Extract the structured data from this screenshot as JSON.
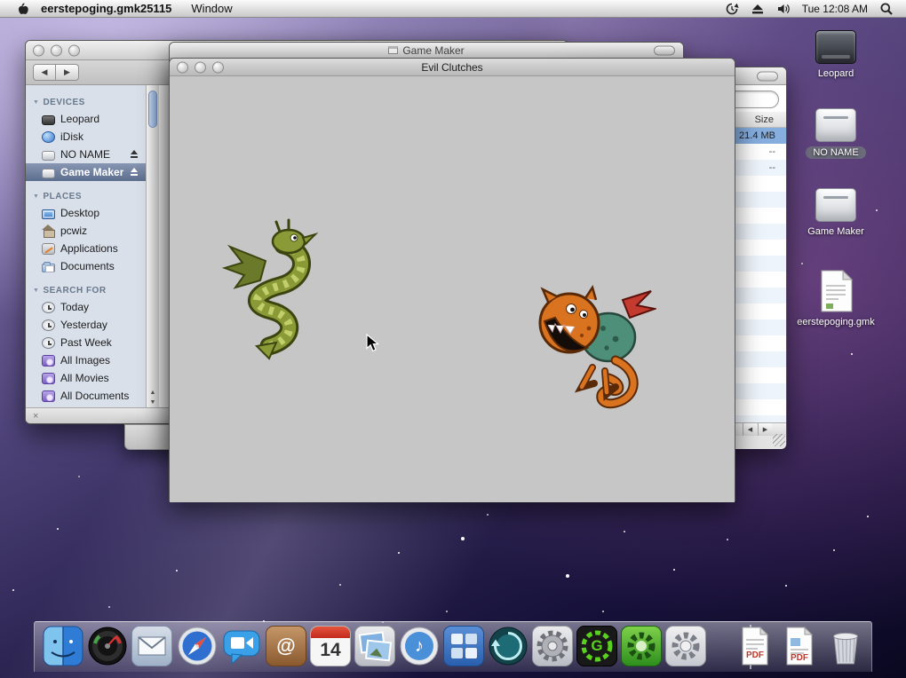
{
  "menu_bar": {
    "app_name": "eerstepoging.gmk25115",
    "window_menu": "Window",
    "clock": "Tue 12:08 AM"
  },
  "finder": {
    "section_titles": [
      "DEVICES",
      "PLACES",
      "SEARCH FOR"
    ],
    "devices": [
      "Leopard",
      "iDisk",
      "NO NAME",
      "Game Maker"
    ],
    "places": [
      "Desktop",
      "pcwiz",
      "Applications",
      "Documents"
    ],
    "search_for": [
      "Today",
      "Yesterday",
      "Past Week",
      "All Images",
      "All Movies",
      "All Documents"
    ],
    "nav": {
      "back": "◀",
      "forward": "▶"
    },
    "scroll": {
      "up": "▲",
      "down": "▼",
      "left": "◀",
      "right": "▶"
    },
    "disclosure": "▼",
    "status_icon": "×"
  },
  "game_maker_window": {
    "title": "Game Maker"
  },
  "resource_window": {
    "size_header": "Size",
    "rows": [
      "21.4 MB",
      "--",
      "--"
    ]
  },
  "game_window": {
    "title": "Evil Clutches"
  },
  "desktop_icons": {
    "labels": [
      "Leopard",
      "NO NAME",
      "Game Maker",
      "eerstepoging.gmk"
    ]
  },
  "dock": {
    "ical_day": "14",
    "address_glyph": "@",
    "note_glyph": "♪",
    "gm_glyph": "G",
    "pdf_label": "PDF"
  },
  "colors": {
    "selection_blue": "#86aede",
    "sidebar_selection": "#5c6e8e",
    "game_background": "#c6c6c6"
  }
}
